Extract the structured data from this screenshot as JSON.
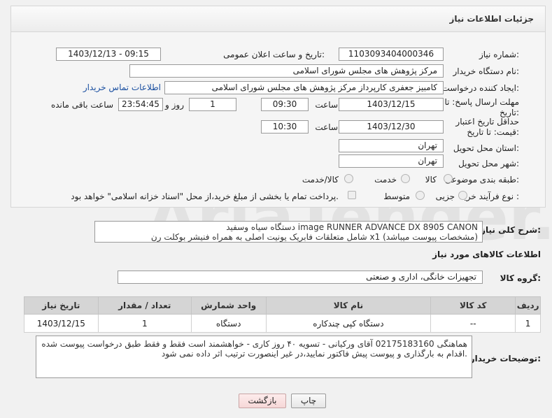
{
  "header": {
    "title": "جزئیات اطلاعات نیاز"
  },
  "labels": {
    "need_number": "شماره نیاز:",
    "announce_datetime": "تاریخ و ساعت اعلان عمومی:",
    "buyer_org": "نام دستگاه خریدار:",
    "requester": "ایجاد کننده درخواست:",
    "reply_deadline": "مهلت ارسال پاسخ: تا تاریخ:",
    "price_validity": "حداقل تاریخ اعتبار قیمت: تا تاریخ:",
    "time": "ساعت",
    "day_and": "روز و",
    "remaining": "ساعت باقی مانده",
    "delivery_province": "استان محل تحویل:",
    "delivery_city": "شهر محل تحویل:",
    "category": "طبقه بندی موضوعی:",
    "purchase_type": "نوع فرآیند خرید :",
    "description": "شرح کلی نیاز:",
    "goods_info": "اطلاعات کالاهای مورد نیاز",
    "goods_group": "گروه کالا:",
    "buyer_notes": "توضیحات خریدار:"
  },
  "values": {
    "need_number": "1103093404000346",
    "announce_datetime": "1403/12/13 - 09:15",
    "buyer_org": "مرکز پژوهش های مجلس شورای اسلامی",
    "requester": "کامبیز جعفری کارپرداز مرکز پژوهش های مجلس شورای اسلامی",
    "contact_link": "اطلاعات تماس خریدار",
    "reply_date": "1403/12/15",
    "reply_time": "09:30",
    "days": "1",
    "remaining_time": "23:54:45",
    "validity_date": "1403/12/30",
    "validity_time": "10:30",
    "province": "تهران",
    "city": "تهران",
    "category_options": [
      "کالا",
      "خدمت",
      "کالا/خدمت"
    ],
    "purchase_options": [
      "جزیی",
      "متوسط"
    ],
    "payment_note": "پرداخت تمام یا بخشی از مبلغ خرید،از محل \"اسناد خزانه اسلامی\" خواهد بود.",
    "description_line1": "دستگاه سیاه وسفید    image RUNNER ADVANCE  DX 8905 CANON",
    "description_line2": "شامل متعلقات فابریک یونیت اصلی به همراه فنیشر بوکلت رن x1 (مشخصات پیوست میباشد)",
    "goods_group": "تجهیزات خانگی، اداری و صنعتی",
    "buyer_notes_line1": "هماهنگی 02175183160 آقای ورکیانی - تسویه ۴۰ روز کاری - خواهشمند است فقط و فقط طبق درخواست پیوست شده",
    "buyer_notes_line2": "اقدام به بارگذاری و پیوست پیش فاکتور نمایید،در غیر اینصورت ترتیب اثر داده نمی شود."
  },
  "table": {
    "headers": [
      "ردیف",
      "کد کالا",
      "نام کالا",
      "واحد شمارش",
      "تعداد / مقدار",
      "تاریخ نیاز"
    ],
    "rows": [
      [
        "1",
        "--",
        "دستگاه کپی چندکاره",
        "دستگاه",
        "1",
        "1403/12/15"
      ]
    ]
  },
  "buttons": {
    "print": "چاپ",
    "back": "بازگشت"
  },
  "watermark": {
    "text": "AriaTender.neT"
  }
}
